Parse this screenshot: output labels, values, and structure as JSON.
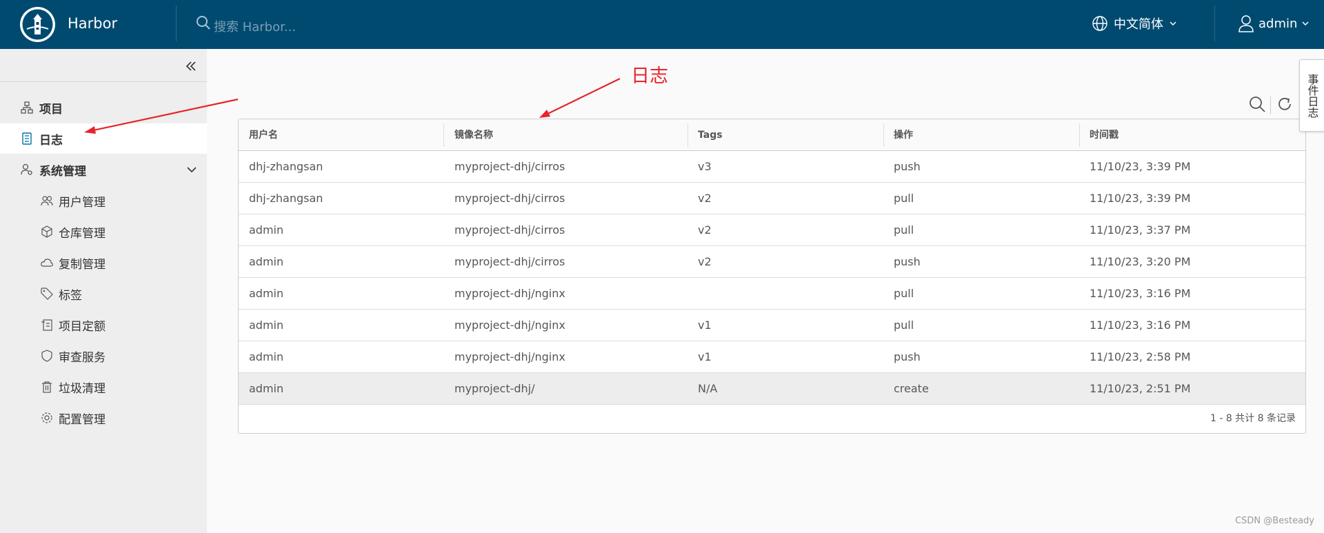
{
  "header": {
    "brand": "Harbor",
    "search_placeholder": "搜索 Harbor...",
    "language": "中文简体",
    "user": "admin"
  },
  "sidebar": {
    "items": [
      {
        "label": "项目",
        "icon": "project-icon"
      },
      {
        "label": "日志",
        "icon": "log-icon",
        "active": true
      },
      {
        "label": "系统管理",
        "icon": "admin-icon",
        "expanded": true
      }
    ],
    "sub_items": [
      {
        "label": "用户管理",
        "icon": "users-icon"
      },
      {
        "label": "仓库管理",
        "icon": "cube-icon"
      },
      {
        "label": "复制管理",
        "icon": "cloud-icon"
      },
      {
        "label": "标签",
        "icon": "tag-icon"
      },
      {
        "label": "项目定额",
        "icon": "quota-icon"
      },
      {
        "label": "审查服务",
        "icon": "shield-icon"
      },
      {
        "label": "垃圾清理",
        "icon": "trash-icon"
      },
      {
        "label": "配置管理",
        "icon": "gear-icon"
      }
    ]
  },
  "annotation": "日志",
  "side_tab": "事件日志",
  "table": {
    "columns": [
      "用户名",
      "镜像名称",
      "Tags",
      "操作",
      "时间戳"
    ],
    "rows": [
      [
        "dhj-zhangsan",
        "myproject-dhj/cirros",
        "v3",
        "push",
        "11/10/23, 3:39 PM"
      ],
      [
        "dhj-zhangsan",
        "myproject-dhj/cirros",
        "v2",
        "pull",
        "11/10/23, 3:39 PM"
      ],
      [
        "admin",
        "myproject-dhj/cirros",
        "v2",
        "pull",
        "11/10/23, 3:37 PM"
      ],
      [
        "admin",
        "myproject-dhj/cirros",
        "v2",
        "push",
        "11/10/23, 3:20 PM"
      ],
      [
        "admin",
        "myproject-dhj/nginx",
        "",
        "pull",
        "11/10/23, 3:16 PM"
      ],
      [
        "admin",
        "myproject-dhj/nginx",
        "v1",
        "pull",
        "11/10/23, 3:16 PM"
      ],
      [
        "admin",
        "myproject-dhj/nginx",
        "v1",
        "push",
        "11/10/23, 2:58 PM"
      ],
      [
        "admin",
        "myproject-dhj/",
        "N/A",
        "create",
        "11/10/23, 2:51 PM"
      ]
    ],
    "selected_row": 7,
    "footer": "1 - 8 共计 8 条记录"
  },
  "watermark": "CSDN @Besteady",
  "colors": {
    "header_bg": "#004a70",
    "annotation": "#e8242a"
  }
}
